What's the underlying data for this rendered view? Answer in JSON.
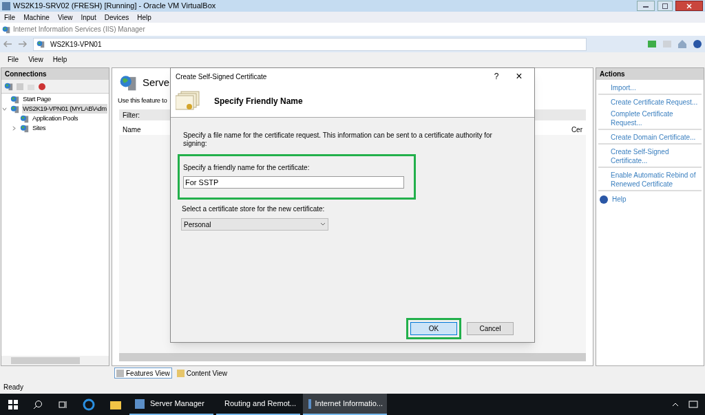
{
  "host_window": {
    "title": "WS2K19-SRV02 (FRESH) [Running] - Oracle VM VirtualBox",
    "menu": [
      "File",
      "Machine",
      "View",
      "Input",
      "Devices",
      "Help"
    ]
  },
  "iis_window": {
    "title": "Internet Information Services (IIS) Manager",
    "breadcrumb": [
      "WS2K19-VPN01"
    ],
    "menu": [
      "File",
      "View",
      "Help"
    ]
  },
  "connections": {
    "title": "Connections",
    "tree": [
      {
        "label": "Start Page",
        "selected": false
      },
      {
        "label": "WS2K19-VPN01 (MYLAB\\Adm",
        "selected": true,
        "expanded": true,
        "children": [
          {
            "label": "Application Pools",
            "selected": false
          },
          {
            "label": "Sites",
            "selected": false,
            "expanded": false
          }
        ]
      }
    ]
  },
  "feature": {
    "title": "Serve",
    "description": "Use this feature to",
    "filter_label": "Filter:",
    "columns": [
      "Name",
      "Cer"
    ],
    "views": [
      {
        "label": "Features View",
        "selected": true
      },
      {
        "label": "Content View",
        "selected": false
      }
    ]
  },
  "dialog": {
    "title": "Create Self-Signed Certificate",
    "help": "?",
    "close": "×",
    "heading": "Specify Friendly Name",
    "description": "Specify a file name for the certificate request.  This information can be sent to a certificate authority for signing:",
    "name_label": "Specify a friendly name for the certificate:",
    "name_value": "For SSTP",
    "name_highlighted": true,
    "store_label": "Select a certificate store for the new certificate:",
    "store_value": "Personal",
    "buttons": [
      {
        "label": "OK",
        "default": true,
        "highlighted": true
      },
      {
        "label": "Cancel",
        "default": false,
        "highlighted": false
      }
    ]
  },
  "actions": {
    "title": "Actions",
    "items": [
      {
        "label": "Import...",
        "kind": "link",
        "divider_after": true
      },
      {
        "label": "Create Certificate Request...",
        "kind": "link",
        "divider_after": false
      },
      {
        "label": "Complete Certificate Request...",
        "kind": "link",
        "divider_after": true
      },
      {
        "label": "Create Domain Certificate...",
        "kind": "link",
        "divider_after": true
      },
      {
        "label": "Create Self-Signed Certificate...",
        "kind": "link",
        "divider_after": true
      },
      {
        "label": "Enable Automatic Rebind of Renewed Certificate",
        "kind": "link",
        "divider_after": true
      },
      {
        "label": "Help",
        "kind": "help",
        "divider_after": false
      }
    ]
  },
  "status_bar": "Ready",
  "taskbar": {
    "apps": [
      {
        "label": "Server Manager",
        "selected": false
      },
      {
        "label": "Routing and Remot...",
        "selected": false
      },
      {
        "label": "Internet Informatio...",
        "selected": true
      }
    ]
  }
}
